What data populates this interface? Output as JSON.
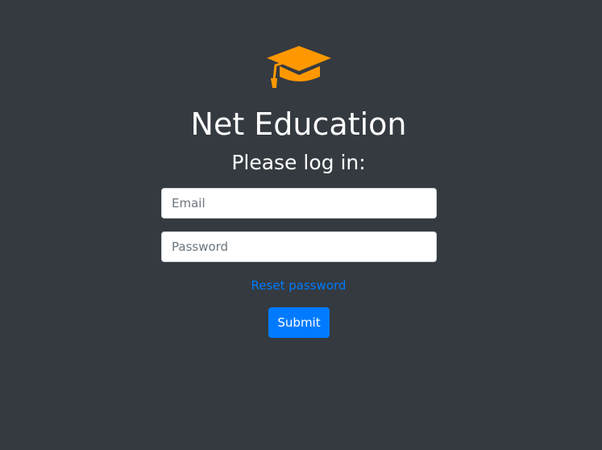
{
  "logo": {
    "icon": "graduation-cap-icon",
    "color": "#ff9800"
  },
  "title": "Net Education",
  "subtitle": "Please log in:",
  "form": {
    "email_placeholder": "Email",
    "email_value": "",
    "password_placeholder": "Password",
    "password_value": "",
    "reset_label": "Reset password",
    "submit_label": "Submit"
  },
  "colors": {
    "background": "#343a40",
    "accent": "#007bff",
    "text": "#ffffff"
  }
}
